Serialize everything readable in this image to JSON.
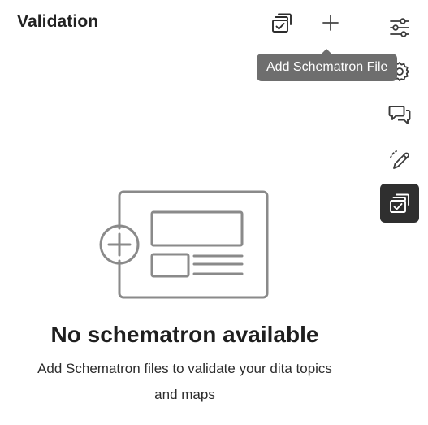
{
  "panel": {
    "title": "Validation"
  },
  "header_actions": [
    {
      "icon": "validate-stack-icon"
    },
    {
      "icon": "add-icon"
    }
  ],
  "tooltip": {
    "text": "Add Schematron File"
  },
  "empty_state": {
    "icon": "add-document-illustration",
    "title": "No schematron available",
    "description": "Add Schematron files to validate your dita topics and maps"
  },
  "right_rail": [
    {
      "icon": "sliders-icon",
      "active": false
    },
    {
      "icon": "gear-icon",
      "active": false
    },
    {
      "icon": "comments-icon",
      "active": false
    },
    {
      "icon": "pencil-icon",
      "active": false
    },
    {
      "icon": "validation-icon",
      "active": true
    }
  ],
  "colors": {
    "accent_active_bg": "#2f2f2f",
    "tooltip_bg": "#6e6e6e",
    "icon": "#4b4b4b"
  }
}
